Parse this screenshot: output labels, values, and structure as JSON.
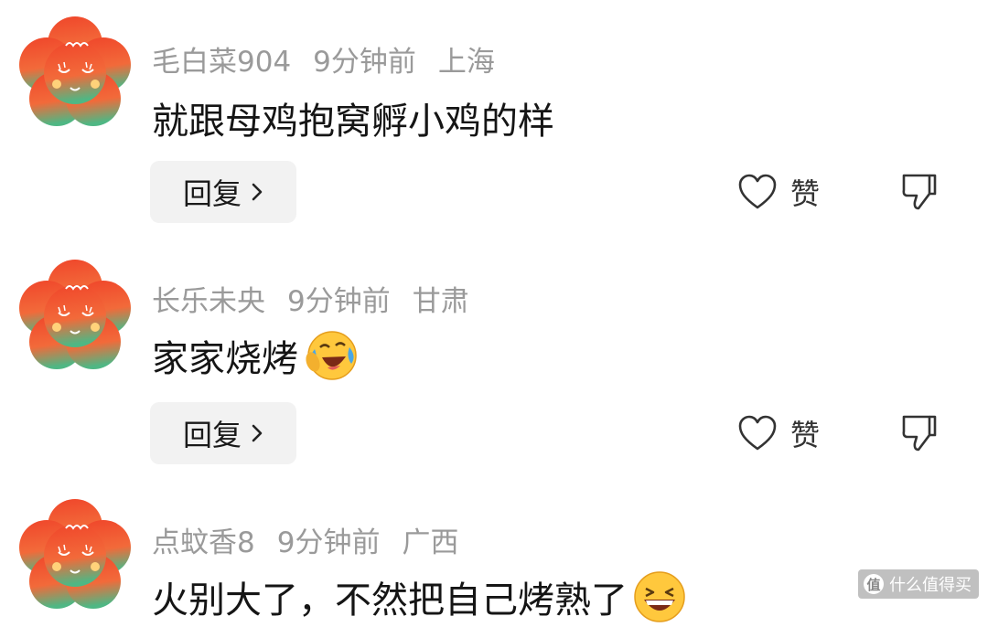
{
  "comments": [
    {
      "username": "毛白菜904",
      "time": "9分钟前",
      "location": "上海",
      "content": "就跟母鸡抱窝孵小鸡的样",
      "emoji": "",
      "reply_label": "回复",
      "like_label": "赞"
    },
    {
      "username": "长乐未央",
      "time": "9分钟前",
      "location": "甘肃",
      "content": "家家烧烤",
      "emoji": "laughing-crying-emoji",
      "reply_label": "回复",
      "like_label": "赞"
    },
    {
      "username": "点蚊香8",
      "time": "9分钟前",
      "location": "广西",
      "content": "火别大了，不然把自己烤熟了",
      "emoji": "grinning-emoji",
      "reply_label": "回复",
      "like_label": "赞"
    }
  ],
  "watermark": {
    "badge": "值",
    "text": "什么值得买"
  },
  "colors": {
    "avatar_top": "#f2542d",
    "avatar_bottom": "#4caf7a",
    "meta_text": "#9a9a9a",
    "reply_bg": "#f2f2f2"
  }
}
